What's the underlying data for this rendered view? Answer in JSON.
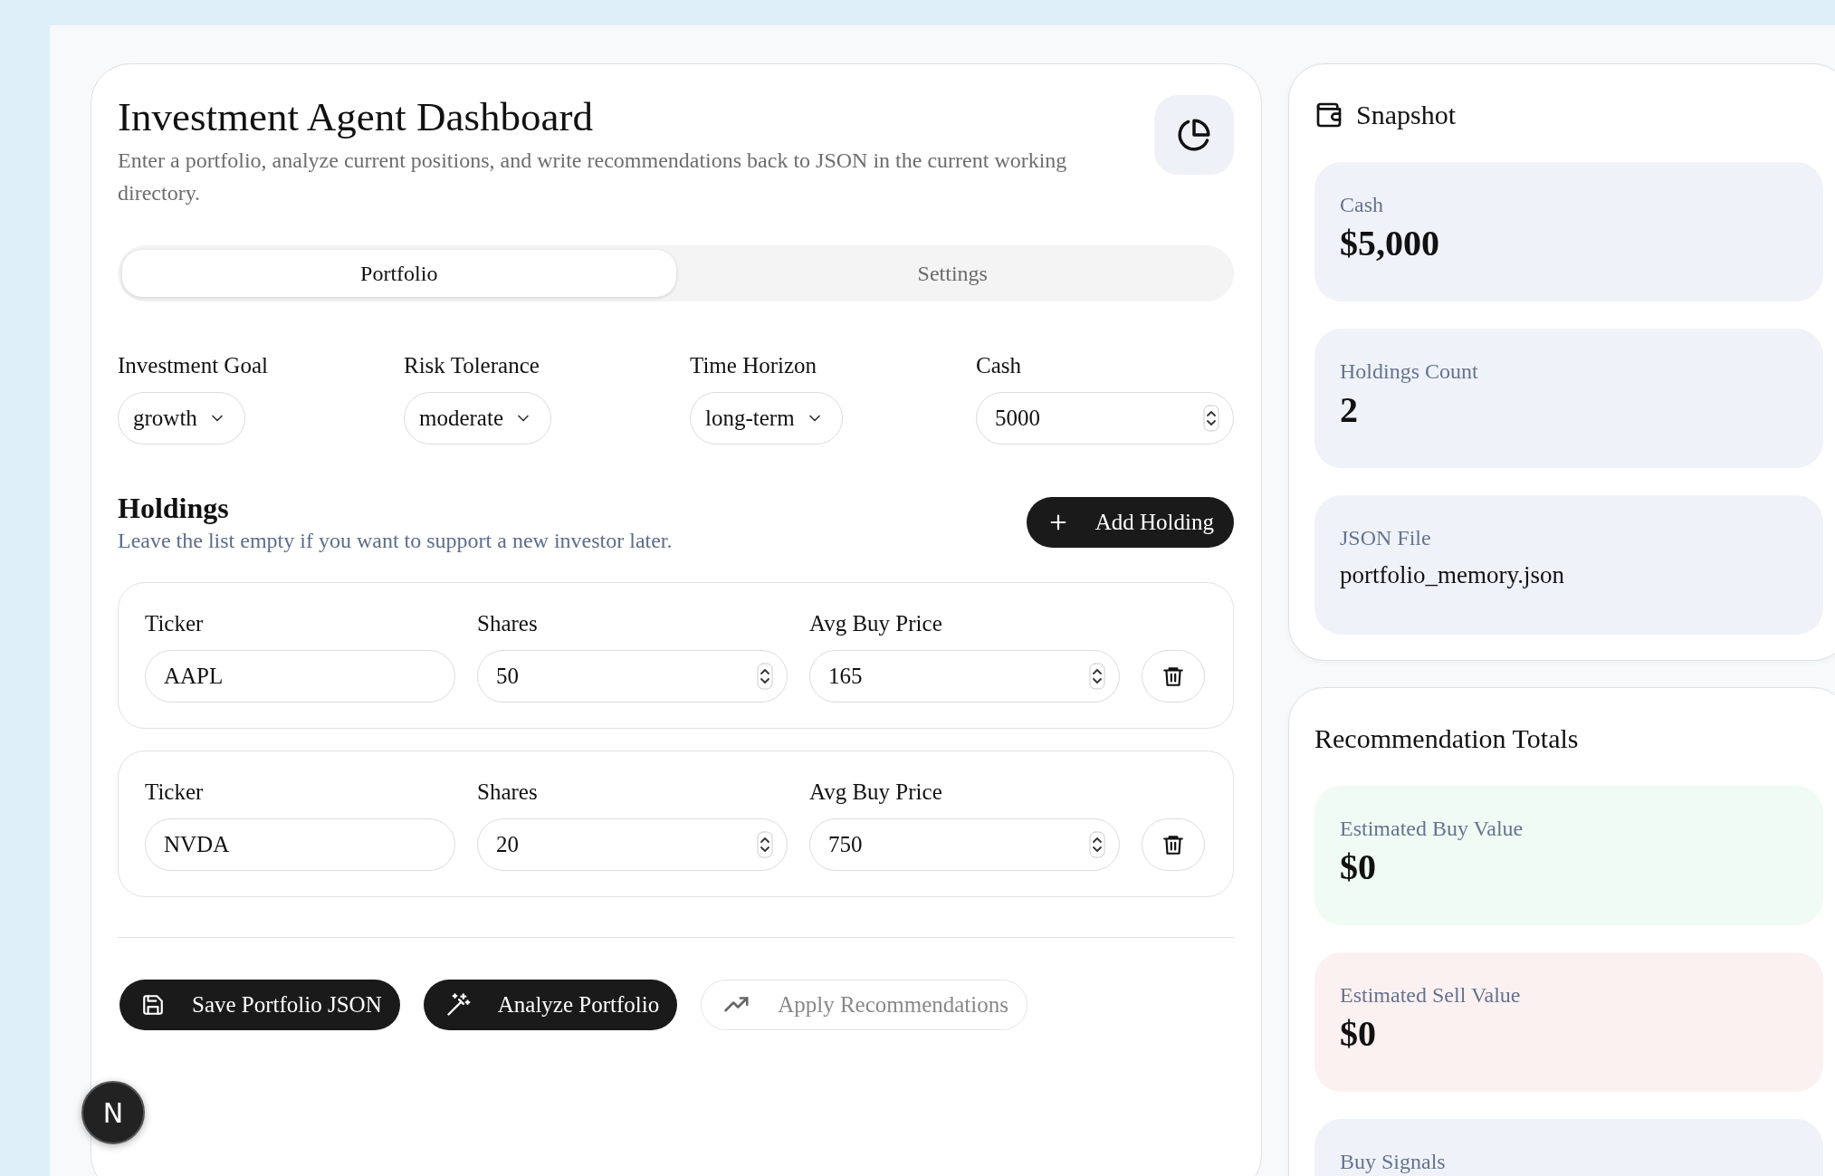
{
  "header": {
    "title": "Investment Agent Dashboard",
    "subtitle": "Enter a portfolio, analyze current positions, and write recommendations back to JSON in the current working directory."
  },
  "tabs": [
    {
      "label": "Portfolio",
      "selected": true
    },
    {
      "label": "Settings",
      "selected": false
    }
  ],
  "fields": [
    {
      "label": "Investment Goal",
      "kind": "select",
      "value": "growth"
    },
    {
      "label": "Risk Tolerance",
      "kind": "select",
      "value": "moderate"
    },
    {
      "label": "Time Horizon",
      "kind": "select",
      "value": "long-term"
    },
    {
      "label": "Cash",
      "kind": "number",
      "value": "5000"
    }
  ],
  "holdings_section": {
    "title": "Holdings",
    "hint": "Leave the list empty if you want to support a new investor later.",
    "add_button": "Add Holding"
  },
  "holdings": [
    {
      "ticker_label": "Ticker",
      "ticker": "AAPL",
      "shares_label": "Shares",
      "shares": "50",
      "price_label": "Avg Buy Price",
      "avg_buy_price": "165"
    },
    {
      "ticker_label": "Ticker",
      "ticker": "NVDA",
      "shares_label": "Shares",
      "shares": "20",
      "price_label": "Avg Buy Price",
      "avg_buy_price": "750"
    }
  ],
  "actions": [
    {
      "label": "Save Portfolio JSON",
      "disabled": false
    },
    {
      "label": "Analyze Portfolio",
      "disabled": false
    },
    {
      "label": "Apply Recommendations",
      "disabled": true
    }
  ],
  "dev_badge": "N",
  "snapshot": {
    "title": "Snapshot",
    "stats": [
      {
        "label": "Cash",
        "value": "$5,000",
        "kind": "amount"
      },
      {
        "label": "Holdings Count",
        "value": "2",
        "kind": "amount"
      },
      {
        "label": "JSON File",
        "value": "portfolio_memory.json",
        "kind": "text"
      }
    ]
  },
  "recommendation_totals": {
    "title": "Recommendation Totals",
    "stats": [
      {
        "label": "Estimated Buy Value",
        "value": "$0",
        "kind": "amount",
        "color": "#effbf4"
      },
      {
        "label": "Estimated Sell Value",
        "value": "$0",
        "kind": "amount",
        "color": "#fcf1f1"
      },
      {
        "label": "Buy Signals"
      }
    ]
  }
}
